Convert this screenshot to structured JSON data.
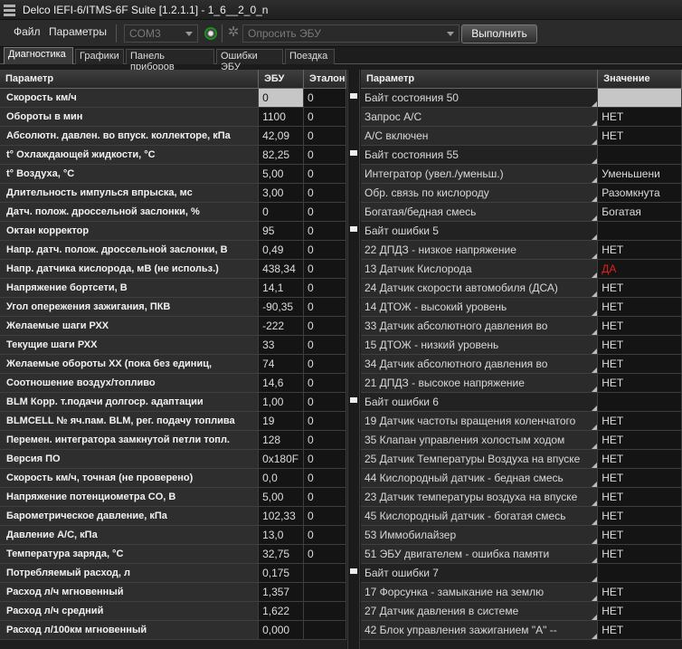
{
  "window": {
    "title": "Delco IEFI-6/ITMS-6F Suite [1.2.1.1] - 1_6__2_0_n"
  },
  "menu": {
    "file": "Файл",
    "params": "Параметры"
  },
  "toolbar": {
    "port_value": "COM3",
    "ecu_query_value": "Опросить ЭБУ",
    "execute_label": "Выполнить"
  },
  "tabs": [
    {
      "label": "Диагностика"
    },
    {
      "label": "Графики"
    },
    {
      "label": "Панель приборов"
    },
    {
      "label": "Ошибки ЭБУ"
    },
    {
      "label": "Поездка"
    }
  ],
  "left_table": {
    "headers": {
      "param": "Параметр",
      "ecu": "ЭБУ",
      "ref": "Эталон"
    },
    "rows": [
      {
        "name": "Скорость км/ч",
        "ecu": "0",
        "ref": "0"
      },
      {
        "name": "Обороты в мин",
        "ecu": "1100",
        "ref": "0"
      },
      {
        "name": "Абсолютн. давлен. во впуск. коллекторе, кПа",
        "ecu": "42,09",
        "ref": "0"
      },
      {
        "name": "t° Охлаждающей жидкости, °С",
        "ecu": "82,25",
        "ref": "0"
      },
      {
        "name": "t° Воздуха, °С",
        "ecu": "5,00",
        "ref": "0"
      },
      {
        "name": "Длительность импулься впрыска, мс",
        "ecu": "3,00",
        "ref": "0"
      },
      {
        "name": "Датч. полож. дроссельной заслонки, %",
        "ecu": "0",
        "ref": "0"
      },
      {
        "name": "Октан корректор",
        "ecu": "95",
        "ref": "0"
      },
      {
        "name": "Напр. датч. полож. дроссельной заслонки, В",
        "ecu": "0,49",
        "ref": "0"
      },
      {
        "name": "Напр. датчика кислорода, мВ (не использ.)",
        "ecu": "438,34",
        "ref": "0"
      },
      {
        "name": "Напряжение бортсети, В",
        "ecu": "14,1",
        "ref": "0"
      },
      {
        "name": "Угол опережения зажигания, ПКВ",
        "ecu": "-90,35",
        "ref": "0"
      },
      {
        "name": "Желаемые шаги РХХ",
        "ecu": "-222",
        "ref": "0"
      },
      {
        "name": "Текущие шаги РХХ",
        "ecu": "33",
        "ref": "0"
      },
      {
        "name": "Желаемые обороты ХХ (пока без единиц,",
        "ecu": "74",
        "ref": "0"
      },
      {
        "name": "Соотношение воздух/топливо",
        "ecu": "14,6",
        "ref": "0"
      },
      {
        "name": "BLM Корр. т.подачи долгоср. адаптации",
        "ecu": "1,00",
        "ref": "0"
      },
      {
        "name": "BLMCELL № яч.пам. BLM, рег. подачу топлива",
        "ecu": "19",
        "ref": "0"
      },
      {
        "name": "Перемен. интегратора замкнутой петли топл.",
        "ecu": "128",
        "ref": "0"
      },
      {
        "name": "Версия ПО",
        "ecu": "0x180F",
        "ref": "0"
      },
      {
        "name": "Скорость км/ч, точная (не проверено)",
        "ecu": "0,0",
        "ref": "0"
      },
      {
        "name": "Напряжение потенциометра CO, В",
        "ecu": "5,00",
        "ref": "0"
      },
      {
        "name": "Барометрическое давление, кПа",
        "ecu": "102,33",
        "ref": "0"
      },
      {
        "name": "Давление А/С, кПа",
        "ecu": "13,0",
        "ref": "0"
      },
      {
        "name": "Температура заряда, °С",
        "ecu": "32,75",
        "ref": "0"
      },
      {
        "name": "Потребляемый расход, л",
        "ecu": "0,175",
        "ref": ""
      },
      {
        "name": "Расход л/ч мгновенный",
        "ecu": "1,357",
        "ref": ""
      },
      {
        "name": "Расход л/ч средний",
        "ecu": "1,622",
        "ref": ""
      },
      {
        "name": "Расход л/100км мгновенный",
        "ecu": "0,000",
        "ref": ""
      }
    ]
  },
  "right_table": {
    "headers": {
      "param": "Параметр",
      "value": "Значение"
    },
    "rows": [
      {
        "name": "Байт состояния 50",
        "value": "",
        "group": true
      },
      {
        "name": "Запрос А/С",
        "value": "НЕТ"
      },
      {
        "name": "А/С включен",
        "value": "НЕТ"
      },
      {
        "name": "Байт состояния 55",
        "value": "",
        "group": true
      },
      {
        "name": "Интегратор (увел./уменьш.)",
        "value": "Уменьшени"
      },
      {
        "name": "Обр. связь по кислороду",
        "value": "Разомкнута"
      },
      {
        "name": "Богатая/бедная смесь",
        "value": "Богатая"
      },
      {
        "name": "Байт ошибки 5",
        "value": "",
        "group": true
      },
      {
        "name": "22 ДПДЗ - низкое напряжение",
        "value": "НЕТ"
      },
      {
        "name": "13 Датчик Кислорода",
        "value": "ДА",
        "alert": true
      },
      {
        "name": "24 Датчик скорости автомобиля (ДСА)",
        "value": "НЕТ"
      },
      {
        "name": "14 ДТОЖ - высокий уровень",
        "value": "НЕТ"
      },
      {
        "name": "33 Датчик абсолютного давления во",
        "value": "НЕТ"
      },
      {
        "name": "15 ДТОЖ - низкий уровень",
        "value": "НЕТ"
      },
      {
        "name": "34 Датчик абсолютного давления во",
        "value": "НЕТ"
      },
      {
        "name": "21 ДПДЗ - высокое напряжение",
        "value": "НЕТ"
      },
      {
        "name": "Байт ошибки 6",
        "value": "",
        "group": true
      },
      {
        "name": "19 Датчик частоты вращения коленчатого",
        "value": "НЕТ"
      },
      {
        "name": "35 Клапан управления холостым ходом",
        "value": "НЕТ"
      },
      {
        "name": "25 Датчик Температуры Воздуха на впуске",
        "value": "НЕТ"
      },
      {
        "name": "44 Кислородный датчик - бедная смесь",
        "value": "НЕТ"
      },
      {
        "name": "23 Датчик температуры воздуха на впуске",
        "value": "НЕТ"
      },
      {
        "name": "45 Кислородный датчик - богатая смесь",
        "value": "НЕТ"
      },
      {
        "name": "53 Иммобилайзер",
        "value": "НЕТ"
      },
      {
        "name": "51 ЭБУ двигателем - ошибка памяти",
        "value": "НЕТ"
      },
      {
        "name": "Байт ошибки 7",
        "value": "",
        "group": true
      },
      {
        "name": "17 Форсунка - замыкание на землю",
        "value": "НЕТ"
      },
      {
        "name": "27 Датчик давления в системе",
        "value": "НЕТ"
      },
      {
        "name": "42 Блок управления зажиганием \"А\" --",
        "value": "НЕТ"
      }
    ]
  },
  "colors": {
    "alert": "#e0201c",
    "selected": "#c6c6c6",
    "led": "#1e8f1e"
  }
}
